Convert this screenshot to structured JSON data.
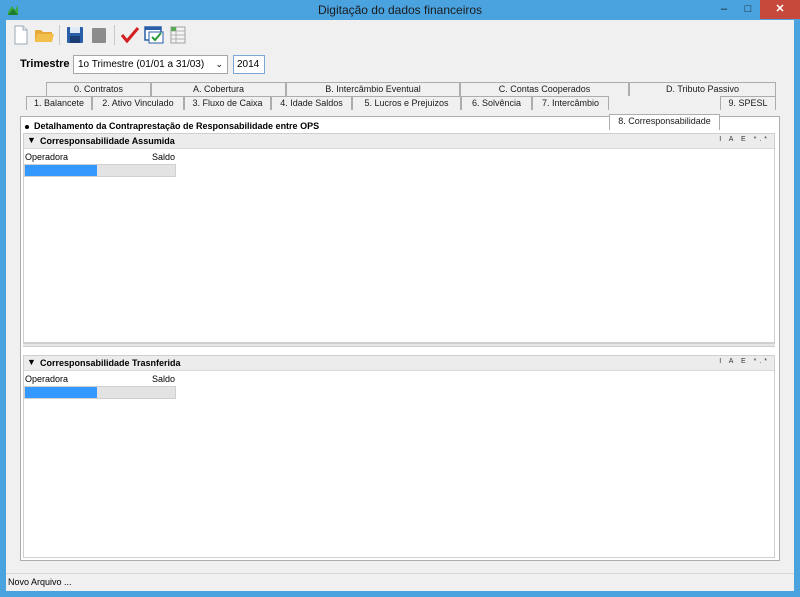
{
  "window": {
    "title": "Digitação do dados financeiros",
    "minimize": "–",
    "maximize": "□",
    "close": "✕"
  },
  "toolbar": {
    "icons": [
      "new-file-icon",
      "open-folder-icon",
      "save-icon",
      "disabled-icon",
      "check-icon",
      "validate-window-icon",
      "spreadsheet-icon"
    ],
    "accent_red": "#d42020",
    "folder_yellow": "#f2c04a",
    "save_blue": "#2a5ea8"
  },
  "filter": {
    "trimestre_label": "Trimestre",
    "trimestre_value": "1o Trimestre (01/01 a 31/03)",
    "year_value": "2014"
  },
  "tabs_row1": [
    "0. Contratos",
    "A. Cobertura",
    "B. Intercâmbio Eventual",
    "C. Contas Cooperados",
    "D. Tributo Passivo"
  ],
  "tabs_row2": [
    "1. Balancete",
    "2. Ativo Vinculado",
    "3. Fluxo de Caixa",
    "4. Idade Saldos",
    "5. Lucros e Prejuizos",
    "6. Solvência",
    "7. Intercâmbio",
    "8. Corresponsabilidade",
    "9. SPESL"
  ],
  "active_tab": "8. Corresponsabilidade",
  "panel": {
    "title": "Detalhamento da Contraprestação de Responsabilidade entre OPS",
    "section_tools": "I A E *.*",
    "sections": [
      {
        "title": "Corresponsabilidade Assumida",
        "col_operadora": "Operadora",
        "col_saldo": "Saldo"
      },
      {
        "title": "Corresponsabilidade Trasnferida",
        "col_operadora": "Operadora",
        "col_saldo": "Saldo"
      }
    ]
  },
  "status": {
    "text": "Novo Arquivo ..."
  },
  "colors": {
    "titlebar": "#4aa3df",
    "close": "#c7493b",
    "selection": "#3399ff"
  }
}
